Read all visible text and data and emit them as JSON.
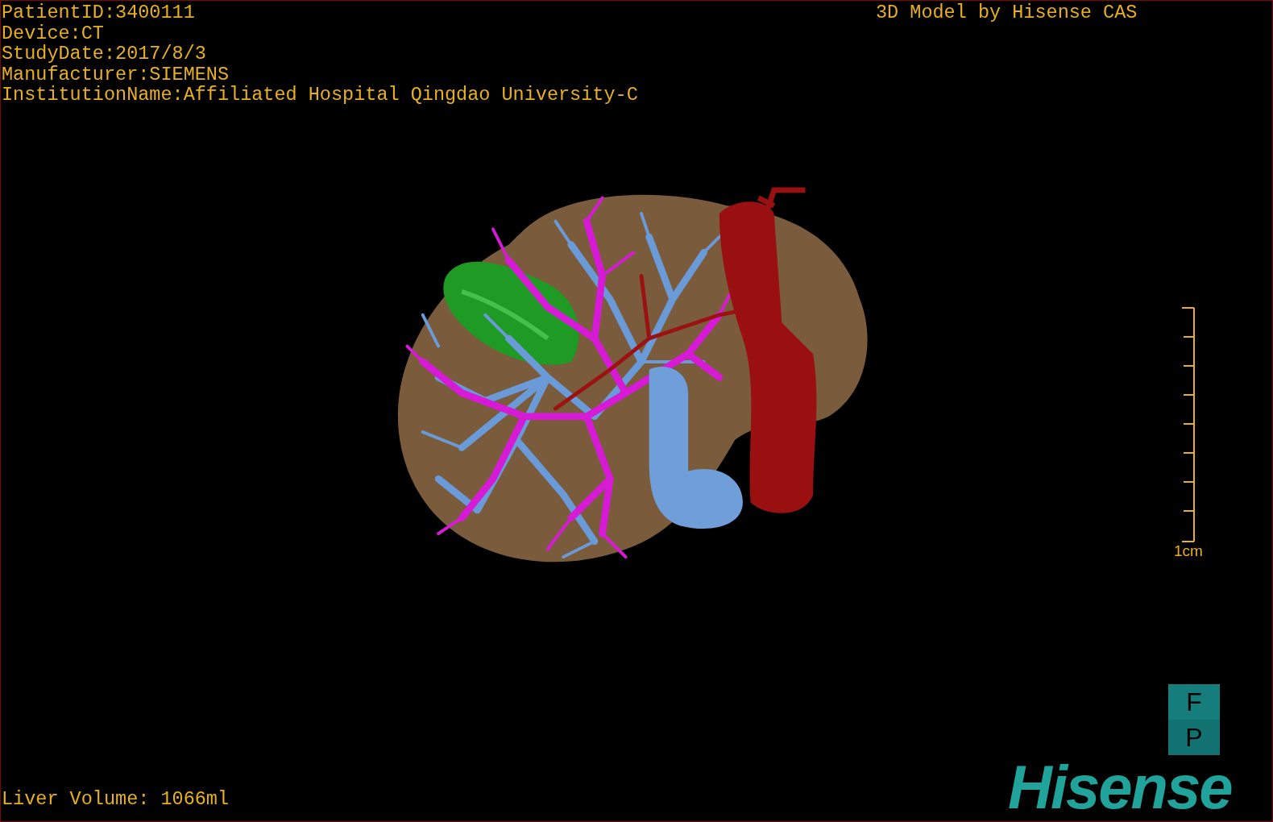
{
  "info_lines": [
    "PatientID:3400111",
    "Device:CT",
    "StudyDate:2017/8/3",
    "Manufacturer:SIEMENS",
    "InstitutionName:Affiliated Hospital Qingdao University-C"
  ],
  "title": "3D Model by Hisense CAS",
  "scale_bar": {
    "label": "1cm"
  },
  "orientation_marker": [
    "F",
    "P"
  ],
  "liver_volume": "Liver Volume: 1066ml",
  "logo": "Hisense"
}
